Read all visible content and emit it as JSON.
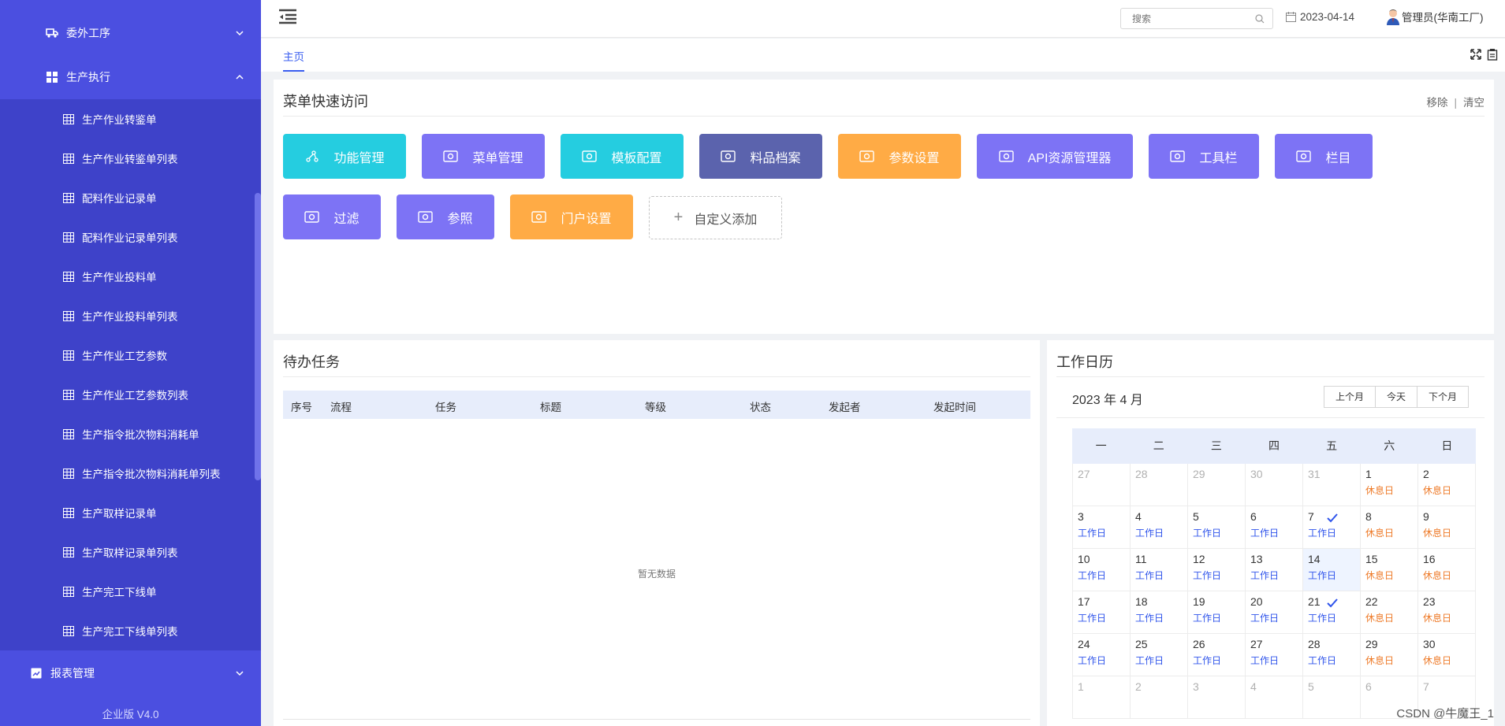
{
  "sidebar": {
    "groups": [
      {
        "label": "委外工序",
        "icon": "truck-icon"
      },
      {
        "label": "生产执行",
        "icon": "grid-icon"
      },
      {
        "label": "报表管理",
        "icon": "chart-icon"
      }
    ],
    "items": [
      "生产作业转鉴单",
      "生产作业转鉴单列表",
      "配料作业记录单",
      "配料作业记录单列表",
      "生产作业投料单",
      "生产作业投料单列表",
      "生产作业工艺参数",
      "生产作业工艺参数列表",
      "生产指令批次物料消耗单",
      "生产指令批次物料消耗单列表",
      "生产取样记录单",
      "生产取样记录单列表",
      "生产完工下线单",
      "生产完工下线单列表"
    ],
    "version": "企业版 V4.0"
  },
  "header": {
    "search_placeholder": "搜索",
    "date": "2023-04-14",
    "user": "管理员(华南工厂)"
  },
  "tabs": {
    "home": "主页"
  },
  "quick_access": {
    "title": "菜单快速访问",
    "remove": "移除",
    "sep": "|",
    "clear": "清空",
    "buttons": [
      {
        "label": "功能管理",
        "color": "#25cde0"
      },
      {
        "label": "菜单管理",
        "color": "#7d73f5"
      },
      {
        "label": "模板配置",
        "color": "#25cde0"
      },
      {
        "label": "料品档案",
        "color": "#5b63ad"
      },
      {
        "label": "参数设置",
        "color": "#ffab45"
      },
      {
        "label": "API资源管理器",
        "color": "#7d73f5"
      },
      {
        "label": "工具栏",
        "color": "#7d73f5"
      },
      {
        "label": "栏目",
        "color": "#7d73f5"
      },
      {
        "label": "过滤",
        "color": "#7d73f5"
      },
      {
        "label": "参照",
        "color": "#7d73f5"
      },
      {
        "label": "门户设置",
        "color": "#ffab45"
      }
    ],
    "add_label": "自定义添加",
    "add_plus": "+"
  },
  "tasks": {
    "title": "待办任务",
    "columns": [
      "序号",
      "流程",
      "任务",
      "标题",
      "等级",
      "状态",
      "发起者",
      "发起时间"
    ],
    "empty_text": "暂无数据"
  },
  "calendar": {
    "title": "工作日历",
    "month": "2023 年 4 月",
    "buttons": [
      "上个月",
      "今天",
      "下个月"
    ],
    "weekdays": [
      "一",
      "二",
      "三",
      "四",
      "五",
      "六",
      "日"
    ],
    "work_label": "工作日",
    "rest_label": "休息日",
    "weeks": [
      [
        {
          "d": "27",
          "o": true
        },
        {
          "d": "28",
          "o": true
        },
        {
          "d": "29",
          "o": true
        },
        {
          "d": "30",
          "o": true
        },
        {
          "d": "31",
          "o": true
        },
        {
          "d": "1",
          "s": "rest"
        },
        {
          "d": "2",
          "s": "rest"
        }
      ],
      [
        {
          "d": "3",
          "s": "work"
        },
        {
          "d": "4",
          "s": "work"
        },
        {
          "d": "5",
          "s": "work"
        },
        {
          "d": "6",
          "s": "work"
        },
        {
          "d": "7",
          "s": "work",
          "c": true
        },
        {
          "d": "8",
          "s": "rest"
        },
        {
          "d": "9",
          "s": "rest"
        }
      ],
      [
        {
          "d": "10",
          "s": "work"
        },
        {
          "d": "11",
          "s": "work"
        },
        {
          "d": "12",
          "s": "work"
        },
        {
          "d": "13",
          "s": "work"
        },
        {
          "d": "14",
          "s": "work",
          "t": true
        },
        {
          "d": "15",
          "s": "rest"
        },
        {
          "d": "16",
          "s": "rest"
        }
      ],
      [
        {
          "d": "17",
          "s": "work"
        },
        {
          "d": "18",
          "s": "work"
        },
        {
          "d": "19",
          "s": "work"
        },
        {
          "d": "20",
          "s": "work"
        },
        {
          "d": "21",
          "s": "work",
          "c": true
        },
        {
          "d": "22",
          "s": "rest"
        },
        {
          "d": "23",
          "s": "rest"
        }
      ],
      [
        {
          "d": "24",
          "s": "work"
        },
        {
          "d": "25",
          "s": "work"
        },
        {
          "d": "26",
          "s": "work"
        },
        {
          "d": "27",
          "s": "work"
        },
        {
          "d": "28",
          "s": "work"
        },
        {
          "d": "29",
          "s": "rest"
        },
        {
          "d": "30",
          "s": "rest"
        }
      ],
      [
        {
          "d": "1",
          "o": true
        },
        {
          "d": "2",
          "o": true
        },
        {
          "d": "3",
          "o": true
        },
        {
          "d": "4",
          "o": true
        },
        {
          "d": "5",
          "o": true
        },
        {
          "d": "6",
          "o": true
        },
        {
          "d": "7",
          "o": true
        }
      ]
    ]
  },
  "footer_watermark": "CSDN @牛魔王_1"
}
